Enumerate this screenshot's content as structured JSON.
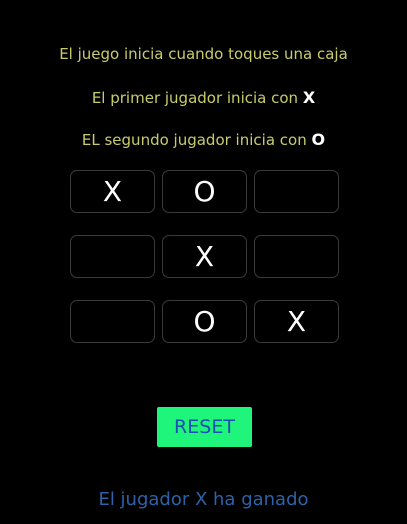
{
  "instructions": {
    "line1": "El juego inicia cuando toques una caja",
    "line2_text": "El primer jugador inicia con ",
    "line2_mark": "X",
    "line3_text": "EL segundo jugador inicia con ",
    "line3_mark": "O"
  },
  "board": {
    "cells": [
      "X",
      "O",
      "",
      "",
      "X",
      "",
      "",
      "O",
      "X"
    ]
  },
  "reset_label": "RESET",
  "status": "El jugador X ha ganado",
  "colors": {
    "background": "#000000",
    "instruction_text": "#c9cc6a",
    "reset_button": "#1ff57a",
    "reset_text": "#1a4fb3",
    "status_text": "#2e62a8"
  }
}
